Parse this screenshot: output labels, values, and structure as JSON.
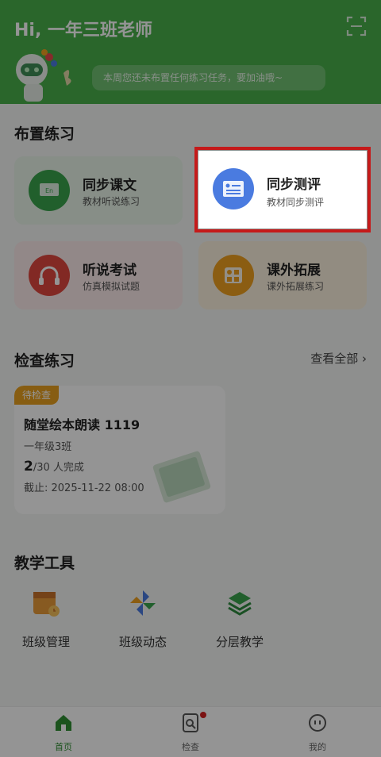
{
  "header": {
    "greeting": "Hi, 一年三班老师",
    "bubble_text": "本周您还未布置任何练习任务，要加油哦~"
  },
  "assign": {
    "title": "布置练习",
    "cards": [
      {
        "title": "同步课文",
        "subtitle": "教材听说练习",
        "color": "#3aa44c"
      },
      {
        "title": "同步测评",
        "subtitle": "教材同步测评",
        "color": "#4a7be0"
      },
      {
        "title": "听说考试",
        "subtitle": "仿真模拟试题",
        "color": "#e0483e"
      },
      {
        "title": "课外拓展",
        "subtitle": "课外拓展练习",
        "color": "#f0a020"
      }
    ]
  },
  "check": {
    "title": "检查练习",
    "view_all": "查看全部",
    "task": {
      "tag": "待检查",
      "name": "随堂绘本朗读 1119",
      "class_name": "一年级3班",
      "done": "2",
      "total_text": "/30 人完成",
      "deadline": "截止: 2025-11-22 08:00"
    }
  },
  "tools": {
    "title": "教学工具",
    "items": [
      {
        "label": "班级管理",
        "icon": "class-management-icon"
      },
      {
        "label": "班级动态",
        "icon": "class-dynamics-icon"
      },
      {
        "label": "分层教学",
        "icon": "layered-teaching-icon"
      }
    ]
  },
  "tabs": [
    {
      "label": "首页",
      "icon": "home-icon",
      "active": true
    },
    {
      "label": "检查",
      "icon": "check-icon",
      "badge": true
    },
    {
      "label": "我的",
      "icon": "profile-icon"
    }
  ],
  "colors": {
    "brand_green": "#49b04b",
    "highlight_red": "#c51a1a"
  }
}
